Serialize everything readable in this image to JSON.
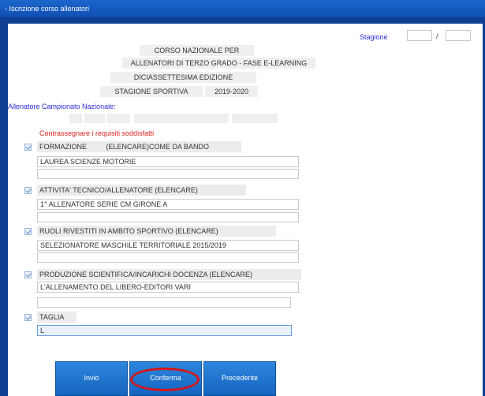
{
  "window": {
    "title": "- Iscrizione corso allenatori"
  },
  "stagione": {
    "label": "Stagione",
    "separator": "/"
  },
  "header": {
    "line1": "CORSO NAZIONALE PER",
    "line2": "ALLENATORI DI TERZO GRADO - FASE E-LEARNING",
    "line3": "DICIASSETTESIMA EDIZIONE",
    "season_label": "STAGIONE SPORTIVA",
    "season_value": "2019-2020"
  },
  "allenatore_label": "Allenatore Campionato Nazionale:",
  "requisiti_label": "Contrassegnare i requisiti soddisfatti",
  "sections": {
    "formazione": {
      "title": "FORMAZIONE",
      "hint": "(ELENCARE)COME DA BANDO",
      "value": "LAUREA SCIENZE MOTORIE"
    },
    "attivita": {
      "title": "ATTIVITA' TECNICO/ALLENATORE (ELENCARE)",
      "value": "1° ALLENATORE SERIE CM GIRONE A"
    },
    "ruoli": {
      "title": "RUOLI RIVESTITI IN AMBITO SPORTIVO (ELENCARE)",
      "value": "SELEZIONATORE MASCHILE TERRITORIALE 2015/2019"
    },
    "produzione": {
      "title": "PRODUZIONE SCIENTIFICA/INCARICHI DOCENZA (ELENCARE)",
      "value": "L'ALLENAMENTO DEL LIBERO-EDITORI VARI"
    },
    "taglia": {
      "title": "TAGLIA",
      "value": "L"
    }
  },
  "buttons": {
    "invio": "Invio",
    "conferma": "Conferma",
    "precedente": "Precedente"
  },
  "colors": {
    "accent": "#1464c0",
    "highlight": "#d4161a",
    "background": "#0e3f92"
  }
}
